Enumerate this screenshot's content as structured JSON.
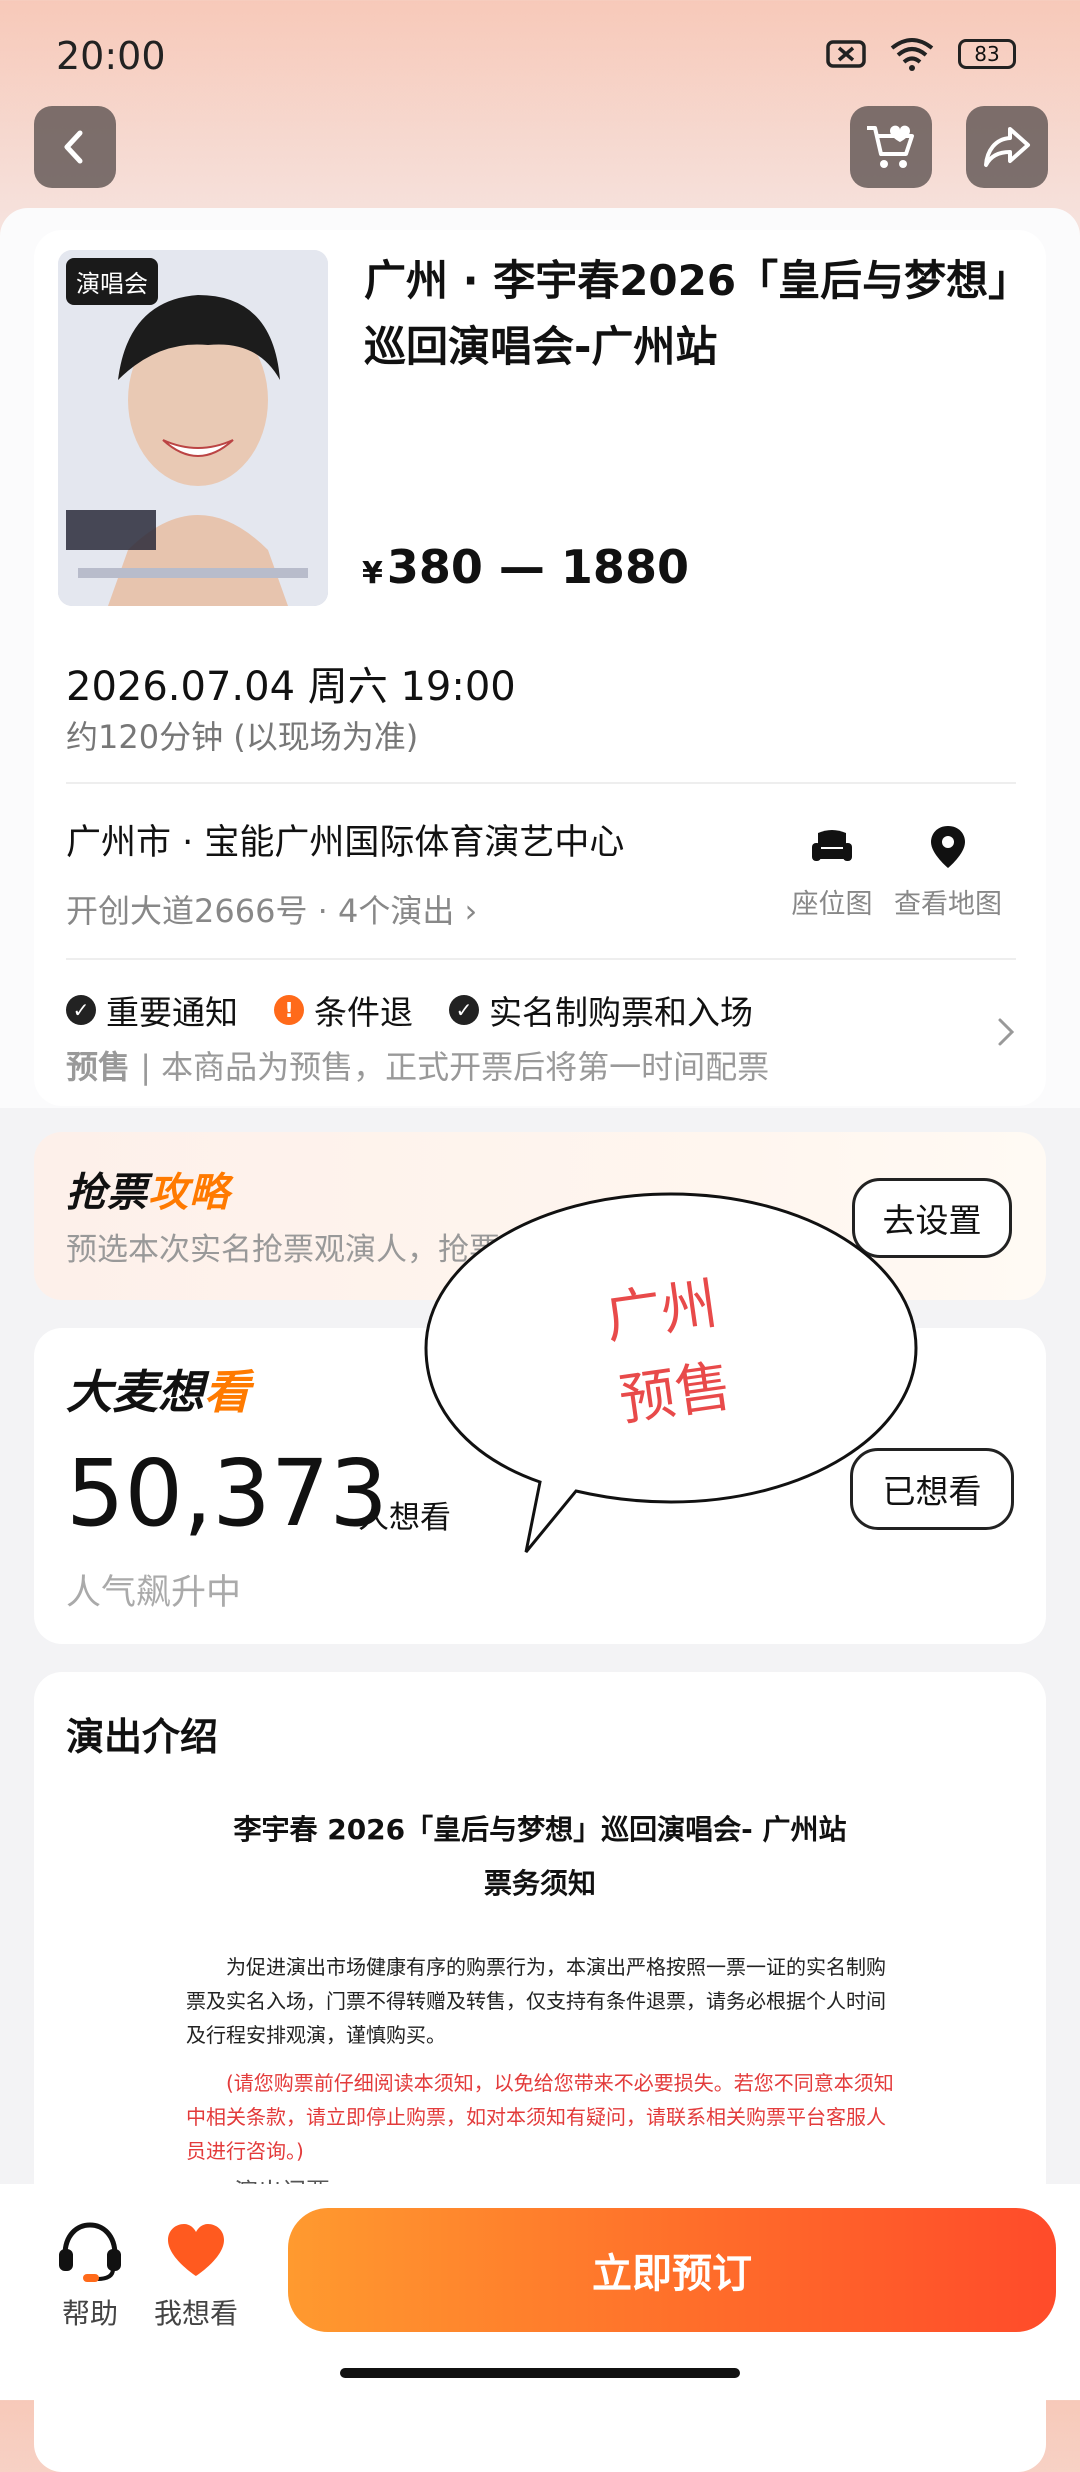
{
  "status_bar": {
    "time": "20:00",
    "battery": "83"
  },
  "show": {
    "poster_tag": "演唱会",
    "title": "广州 · 李宇春2026「皇后与梦想」巡回演唱会-广州站",
    "price_symbol": "¥",
    "price_range": "380 — 1880",
    "datetime": "2026.07.04 周六 19:00",
    "duration": "约120分钟 (以现场为准)",
    "venue": "广州市 · 宝能广州国际体育演艺中心",
    "address": "开创大道2666号 · 4个演出 ›",
    "seat_map_label": "座位图",
    "map_label": "查看地图"
  },
  "notices": {
    "items": [
      {
        "label": "重要通知",
        "color": "#222222"
      },
      {
        "label": "条件退",
        "color": "#ff6a1a"
      },
      {
        "label": "实名制购票和入场",
        "color": "#222222"
      }
    ],
    "presale_tag": "预售",
    "presale_text": " | 本商品为预售，正式开票后将第一时间配票"
  },
  "guide": {
    "title_a": "抢票",
    "title_b": "攻略",
    "desc": "预选本次实名抢票观演人，抢票快",
    "button": "去设置"
  },
  "want": {
    "logo_a": "大麦想",
    "logo_b": "看",
    "count": "50,373",
    "unit": "人想看",
    "trend": "人气飙升中",
    "button": "已想看"
  },
  "bubble": {
    "line1": "广州",
    "line2": "预售"
  },
  "intro": {
    "title": "演出介绍",
    "doc_title_1": "李宇春 2026「皇后与梦想」巡回演唱会- 广州站",
    "doc_title_2": "票务须知",
    "para": "为促进演出市场健康有序的购票行为，本演出严格按照一票一证的实名制购票及实名入场，门票不得转赠及转售，仅支持有条件退票，请务必根据个人时间及行程安排观演，谨慎购买。",
    "red": "(请您购票前仔细阅读本须知，以免给您带来不必要损失。若您不同意本须知中相关条款，请立即停止购票，如对本须知有疑问，请联系相关购票平台客服人员进行咨询。)",
    "cut": "一、演出门票"
  },
  "bottom": {
    "help": "帮助",
    "want": "我想看",
    "buy": "立即预订"
  },
  "colors": {
    "accent": "#ff7a00",
    "buy_gradient_start": "#ff9a2f",
    "buy_gradient_end": "#ff4b2a",
    "bubble_text": "#e84a4a"
  }
}
